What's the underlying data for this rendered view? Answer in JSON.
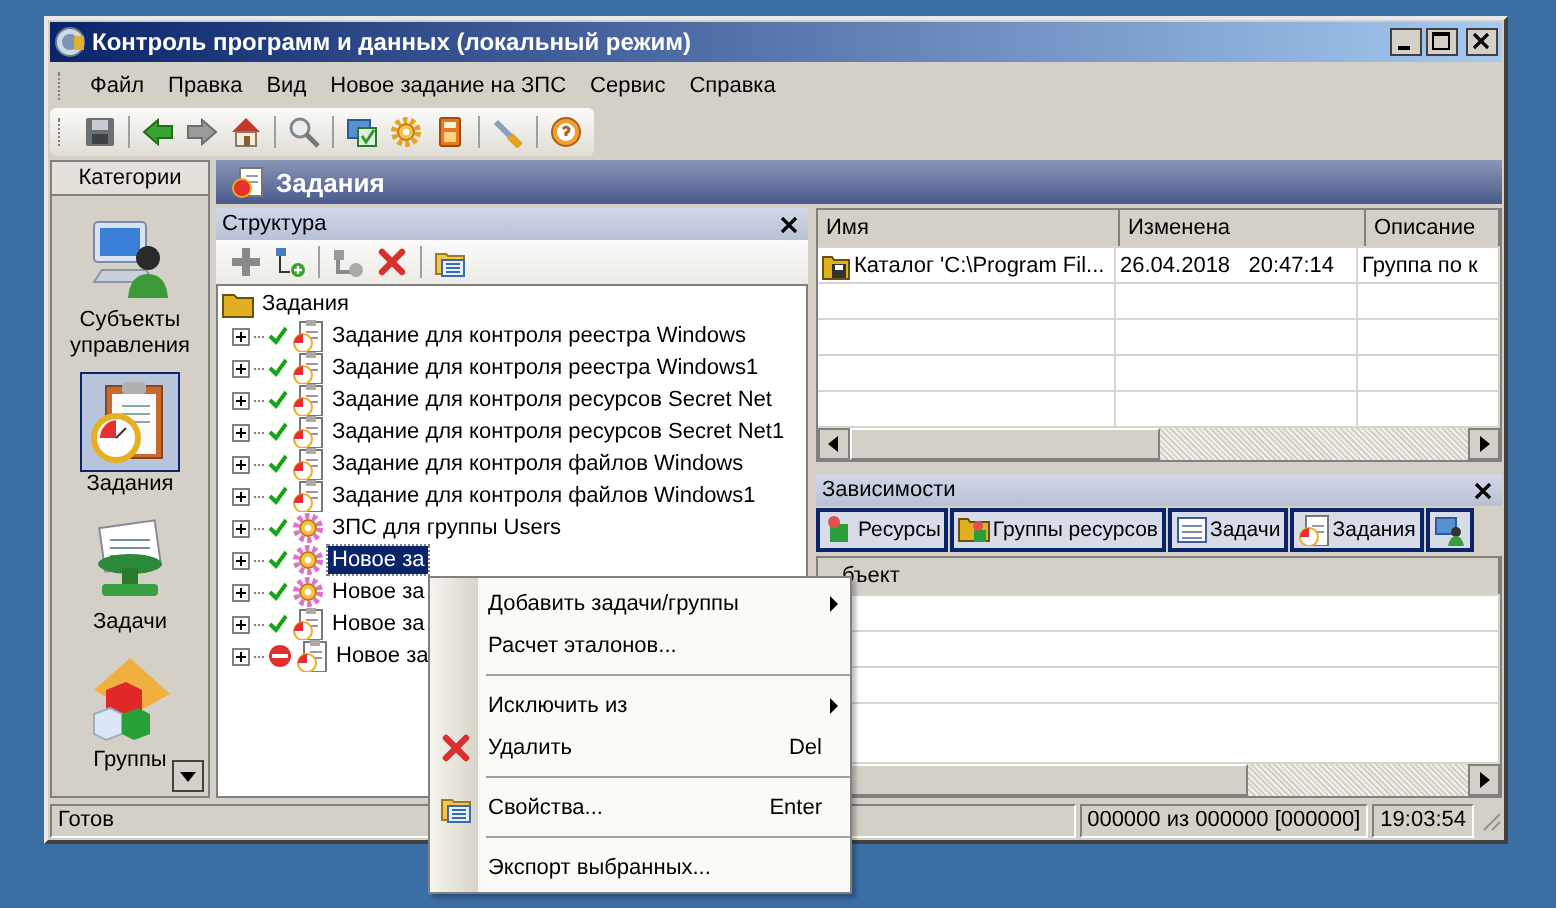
{
  "window": {
    "title": "Контроль программ и данных (локальный режим)"
  },
  "menu": [
    "Файл",
    "Правка",
    "Вид",
    "Новое задание на ЗПС",
    "Сервис",
    "Справка"
  ],
  "categories": {
    "title": "Категории",
    "items": [
      {
        "label": "Субъекты управления",
        "kind": "subjects",
        "selected": false
      },
      {
        "label": "Задания",
        "kind": "jobs",
        "selected": true
      },
      {
        "label": "Задачи",
        "kind": "tasks",
        "selected": false
      },
      {
        "label": "Группы",
        "kind": "groups",
        "selected": false
      }
    ]
  },
  "section_title": "Задания",
  "structure": {
    "title": "Структура",
    "tree": {
      "label": "Задания",
      "children": [
        {
          "label": "Задание для контроля реестра Windows",
          "kind": "job",
          "active": true,
          "expanded": false,
          "selected": false
        },
        {
          "label": "Задание для контроля реестра Windows1",
          "kind": "job",
          "active": true,
          "expanded": false,
          "selected": false
        },
        {
          "label": "Задание для контроля ресурсов Secret Net",
          "kind": "job",
          "active": true,
          "expanded": false,
          "selected": false
        },
        {
          "label": "Задание для контроля ресурсов Secret Net1",
          "kind": "job",
          "active": true,
          "expanded": false,
          "selected": false
        },
        {
          "label": "Задание для контроля файлов Windows",
          "kind": "job",
          "active": true,
          "expanded": false,
          "selected": false
        },
        {
          "label": "Задание для контроля файлов Windows1",
          "kind": "job",
          "active": true,
          "expanded": false,
          "selected": false
        },
        {
          "label": "ЗПС для группы Users",
          "kind": "zps",
          "active": true,
          "expanded": false,
          "selected": false
        },
        {
          "label": "Новое за",
          "kind": "zps",
          "active": true,
          "expanded": false,
          "selected": true
        },
        {
          "label": "Новое за",
          "kind": "zps",
          "active": true,
          "expanded": false,
          "selected": false
        },
        {
          "label": "Новое за",
          "kind": "job",
          "active": true,
          "expanded": false,
          "selected": false
        },
        {
          "label": "Новое за",
          "kind": "job",
          "active": false,
          "expanded": false,
          "selected": false
        }
      ]
    }
  },
  "objects_table": {
    "columns": [
      "Имя",
      "Изменена",
      "Описание"
    ],
    "rows": [
      [
        "Каталог 'C:\\Program Fil...",
        "26.04.2018   20:47:14",
        "Группа по к"
      ]
    ]
  },
  "dependencies": {
    "title": "Зависимости",
    "tabs": [
      {
        "label": "Ресурсы",
        "kind": "resources"
      },
      {
        "label": "Группы ресурсов",
        "kind": "resource_groups"
      },
      {
        "label": "Задачи",
        "kind": "tasks"
      },
      {
        "label": "Задания",
        "kind": "jobs"
      },
      {
        "kind": "subjects"
      }
    ],
    "columns": [
      "бъект"
    ]
  },
  "status_bar": {
    "message": "Готов",
    "counter": "000000 из 000000 [000000]",
    "time": "19:03:54"
  },
  "context_menu": {
    "items": [
      {
        "kind": "item",
        "label": "Добавить задачи/группы",
        "submenu": true
      },
      {
        "kind": "item",
        "label": "Расчет эталонов...",
        "submenu": false
      },
      {
        "kind": "separator"
      },
      {
        "kind": "item",
        "label": "Исключить из",
        "submenu": true
      },
      {
        "kind": "delete",
        "label": "Удалить",
        "shortcut": "Del",
        "submenu": false
      },
      {
        "kind": "separator"
      },
      {
        "kind": "properties",
        "label": "Свойства...",
        "shortcut": "Enter",
        "submenu": false
      },
      {
        "kind": "separator"
      },
      {
        "kind": "item",
        "label": "Экспорт выбранных...",
        "submenu": false
      }
    ]
  }
}
